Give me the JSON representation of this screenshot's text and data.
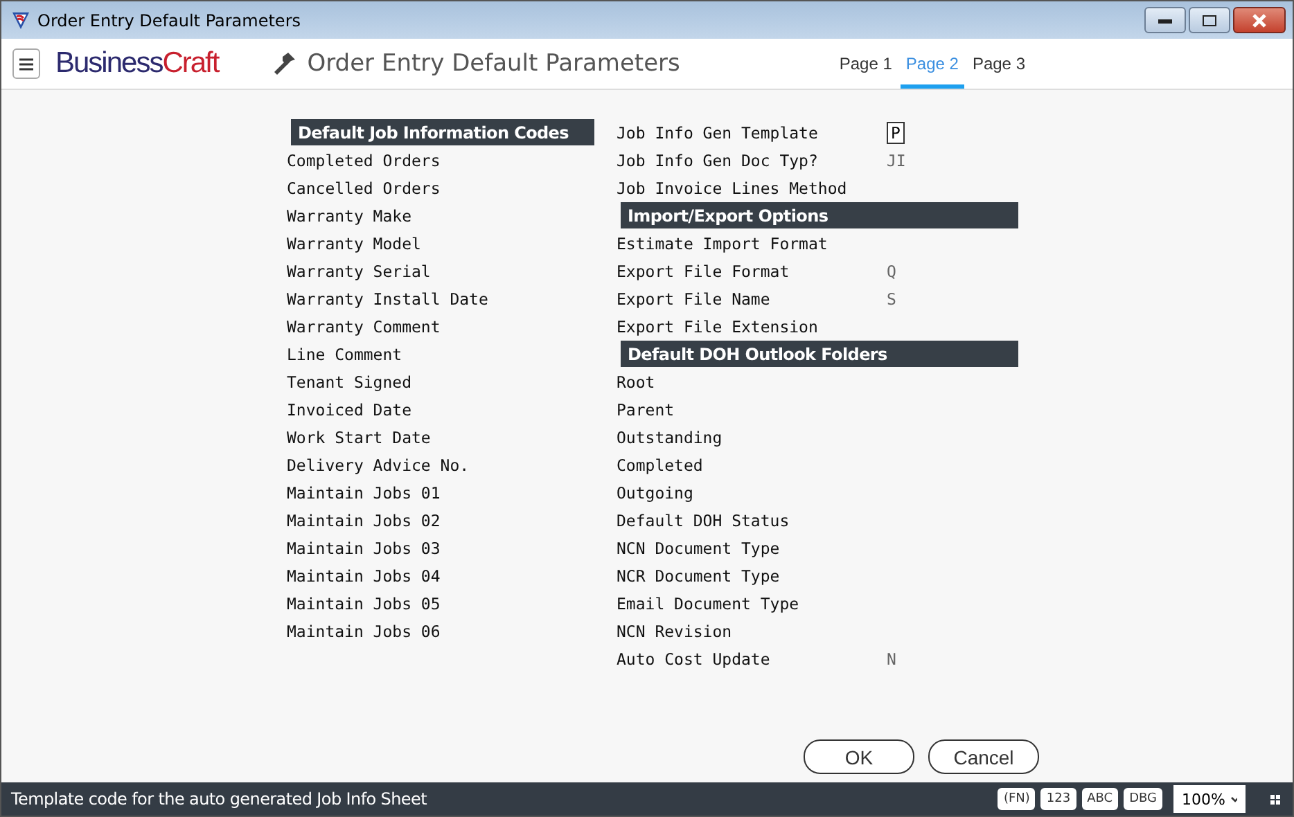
{
  "window": {
    "title": "Order Entry Default Parameters"
  },
  "header": {
    "brand_first": "Business",
    "brand_second": "Craft",
    "title": "Order Entry Default Parameters"
  },
  "tabs": [
    {
      "label": "Page 1",
      "selected": false
    },
    {
      "label": "Page 2",
      "selected": true
    },
    {
      "label": "Page 3",
      "selected": false
    }
  ],
  "left_column": [
    {
      "kind": "header",
      "label": "Default Job Information Codes"
    },
    {
      "kind": "field",
      "label": "Completed Orders",
      "focused": false
    },
    {
      "kind": "field",
      "label": "Cancelled Orders",
      "focused": false
    },
    {
      "kind": "field",
      "label": "Warranty Make",
      "focused": false
    },
    {
      "kind": "field",
      "label": "Warranty Model",
      "focused": false
    },
    {
      "kind": "field",
      "label": "Warranty Serial",
      "focused": false
    },
    {
      "kind": "field",
      "label": "Warranty Install Date",
      "focused": false
    },
    {
      "kind": "field",
      "label": "Warranty Comment",
      "focused": false
    },
    {
      "kind": "field",
      "label": "Line Comment",
      "focused": false
    },
    {
      "kind": "field",
      "label": "Tenant Signed",
      "focused": false
    },
    {
      "kind": "field",
      "label": "Invoiced Date",
      "focused": false
    },
    {
      "kind": "field",
      "label": "Work Start Date",
      "focused": false
    },
    {
      "kind": "field",
      "label": "Delivery Advice No.",
      "focused": false
    },
    {
      "kind": "field",
      "label": "Maintain Jobs 01",
      "focused": false
    },
    {
      "kind": "field",
      "label": "Maintain Jobs 02",
      "focused": false
    },
    {
      "kind": "field",
      "label": "Maintain Jobs 03",
      "focused": false
    },
    {
      "kind": "field",
      "label": "Maintain Jobs 04",
      "focused": false
    },
    {
      "kind": "field",
      "label": "Maintain Jobs 05",
      "focused": false
    },
    {
      "kind": "field",
      "label": "Maintain Jobs 06",
      "focused": false
    }
  ],
  "right_column": [
    {
      "kind": "field",
      "label": "Job Info Gen Template",
      "value": "P",
      "focused": true
    },
    {
      "kind": "field",
      "label": "Job Info Gen Doc Typ?",
      "value": "JI",
      "focused": false
    },
    {
      "kind": "field",
      "label": "Job Invoice Lines Method",
      "focused": false
    },
    {
      "kind": "header",
      "label": "Import/Export Options"
    },
    {
      "kind": "field",
      "label": "Estimate Import Format",
      "focused": false
    },
    {
      "kind": "field",
      "label": "Export File Format",
      "value": "Q",
      "focused": false
    },
    {
      "kind": "field",
      "label": "Export File Name",
      "value": "S",
      "focused": false
    },
    {
      "kind": "field",
      "label": "Export File Extension",
      "focused": false
    },
    {
      "kind": "header",
      "label": "Default DOH Outlook Folders"
    },
    {
      "kind": "field",
      "label": "Root",
      "focused": false
    },
    {
      "kind": "field",
      "label": "Parent",
      "focused": false
    },
    {
      "kind": "field",
      "label": "Outstanding",
      "focused": false
    },
    {
      "kind": "field",
      "label": "Completed",
      "focused": false
    },
    {
      "kind": "field",
      "label": "Outgoing",
      "focused": false
    },
    {
      "kind": "field",
      "label": "Default DOH Status",
      "focused": false
    },
    {
      "kind": "field",
      "label": "NCN Document Type",
      "focused": false
    },
    {
      "kind": "field",
      "label": "NCR Document Type",
      "focused": false
    },
    {
      "kind": "field",
      "label": "Email Document Type",
      "focused": false
    },
    {
      "kind": "field",
      "label": "NCN Revision",
      "focused": false
    },
    {
      "kind": "field",
      "label": "Auto Cost Update",
      "value": "N",
      "focused": false
    }
  ],
  "buttons": [
    "OK",
    "Cancel"
  ],
  "status_bar": {
    "message": "Template code for the auto generated Job Info Sheet",
    "badges": [
      "(FN)",
      "123",
      "ABC",
      "DBG"
    ],
    "zoom": "100%"
  }
}
